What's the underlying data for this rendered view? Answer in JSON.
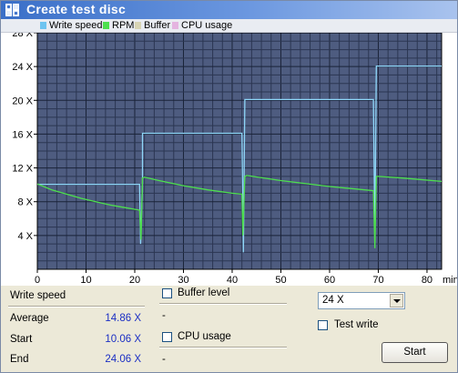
{
  "window": {
    "title": "Create test disc"
  },
  "legend": [
    {
      "label": "Write speed",
      "color": "#6ec4f0"
    },
    {
      "label": "RPM",
      "color": "#4de04d"
    },
    {
      "label": "Buffer",
      "color": "#d8d4b4"
    },
    {
      "label": "CPU usage",
      "color": "#e4b4e0"
    }
  ],
  "chart_data": {
    "type": "line",
    "y_ticks": [
      "4 X",
      "8 X",
      "12 X",
      "16 X",
      "20 X",
      "24 X",
      "28 X"
    ],
    "x_ticks": [
      "0",
      "10",
      "20",
      "30",
      "40",
      "50",
      "60",
      "70",
      "80"
    ],
    "x_unit": "min",
    "xlim": [
      0,
      83
    ],
    "ylim": [
      0,
      28
    ],
    "grid": true,
    "series": [
      {
        "name": "Write speed",
        "color": "#8ed6f8",
        "x": [
          0,
          21,
          21.2,
          21.6,
          21.6,
          42,
          42.3,
          42.6,
          42.6,
          69,
          69.3,
          69.6,
          69.6,
          83
        ],
        "y": [
          10.06,
          10.06,
          3,
          10.1,
          16.1,
          16.1,
          2,
          20.1,
          20.1,
          20.1,
          4,
          24.06,
          24.06,
          24.06
        ]
      },
      {
        "name": "RPM",
        "color": "#4de04d",
        "x": [
          0,
          3,
          6,
          9,
          12,
          15,
          18,
          21,
          21.3,
          21.6,
          22,
          25,
          30,
          35,
          40,
          42,
          42.2,
          42.6,
          43,
          50,
          60,
          69,
          69.3,
          69.6,
          70,
          75,
          83
        ],
        "y": [
          10.1,
          9.4,
          8.9,
          8.4,
          8.0,
          7.6,
          7.3,
          7.0,
          3.5,
          10.8,
          10.9,
          10.5,
          9.9,
          9.4,
          9.0,
          8.9,
          4,
          11.0,
          11.1,
          10.5,
          9.8,
          9.3,
          2.5,
          11.0,
          11.0,
          10.8,
          10.4
        ]
      }
    ]
  },
  "stats": {
    "section_label": "Write speed",
    "average_label": "Average",
    "average_value": "14.86 X",
    "start_label": "Start",
    "start_value": "10.06 X",
    "end_label": "End",
    "end_value": "24.06 X"
  },
  "buffer": {
    "label": "Buffer level",
    "value": "-"
  },
  "cpu": {
    "label": "CPU usage",
    "value": "-"
  },
  "controls": {
    "speed_value": "24 X",
    "test_write_label": "Test write",
    "start_label": "Start"
  }
}
